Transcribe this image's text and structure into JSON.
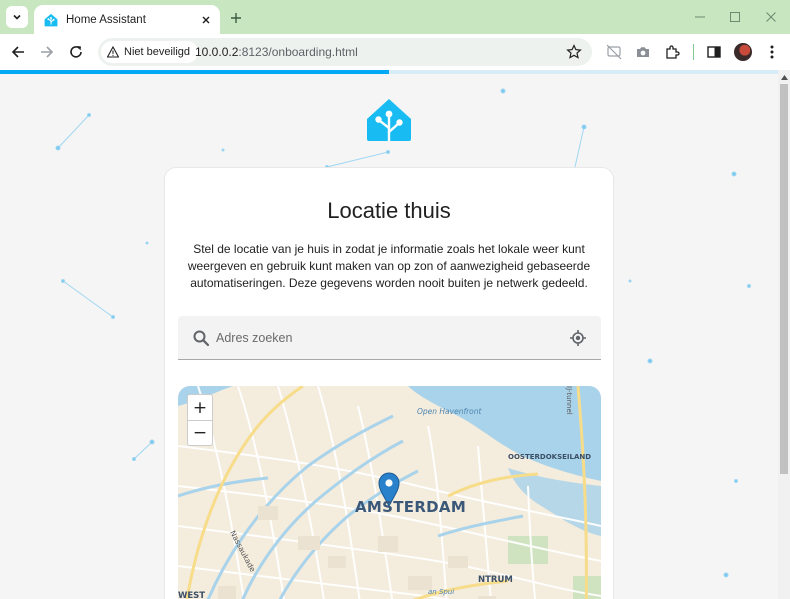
{
  "browser": {
    "tab_title": "Home Assistant",
    "security_label": "Niet beveiligd",
    "url_host": "10.0.0.2",
    "url_rest": ":8123/onboarding.html",
    "accent": "#c8e6c0"
  },
  "page": {
    "progress": 0.5,
    "accent": "#03a9f4",
    "title": "Locatie thuis",
    "description": "Stel de locatie van je huis in zodat je informatie zoals het lokale weer kunt weergeven en gebruik kunt maken van op zon of aanwezigheid gebaseerde automatiseringen. Deze gegevens worden nooit buiten je netwerk gedeeld.",
    "search_placeholder": "Adres zoeken",
    "search_value": ""
  },
  "map": {
    "zoom_in": "+",
    "zoom_out": "−",
    "labels": {
      "city": "AMSTERDAM",
      "open_havenfront": "Open Havenfront",
      "ij_tunnel": "IJ-tunnel",
      "oosterdokseiland": "OOSTERDOKSEILAND",
      "nassaukade": "Nassaukade",
      "centrum": "NTRUM",
      "west": "WEST",
      "spui": "an Spui"
    }
  }
}
